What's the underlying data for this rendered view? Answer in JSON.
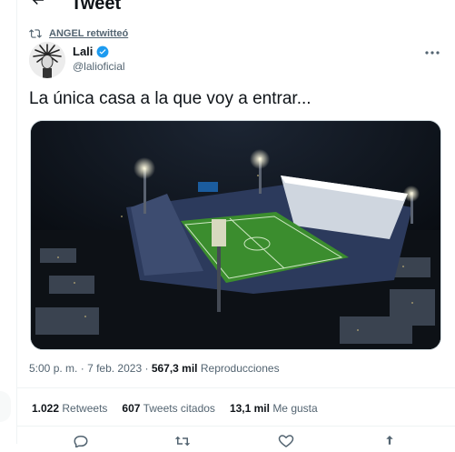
{
  "header": {
    "back_icon": "arrow-left-icon",
    "title": "Tweet"
  },
  "retweet": {
    "icon": "retweet-icon",
    "label": "ANGEL retwitteó"
  },
  "author": {
    "name": "Lali",
    "handle": "@lalioficial",
    "verified_color": "#1d9bf0"
  },
  "tweet": {
    "text": "La única casa a la que voy a entrar...",
    "image_alt": "aerial-night-stadium-photo"
  },
  "meta": {
    "time": "5:00 p. m.",
    "separator": "·",
    "date": "7 feb. 2023",
    "views_count": "567,3 mil",
    "views_label": "Reproducciones"
  },
  "stats": {
    "retweets_count": "1.022",
    "retweets_label": "Retweets",
    "quotes_count": "607",
    "quotes_label": "Tweets citados",
    "likes_count": "13,1 mil",
    "likes_label": "Me gusta"
  },
  "colors": {
    "text": "#0f1419",
    "secondary": "#536471",
    "border": "#eff3f4",
    "accent": "#1d9bf0"
  }
}
